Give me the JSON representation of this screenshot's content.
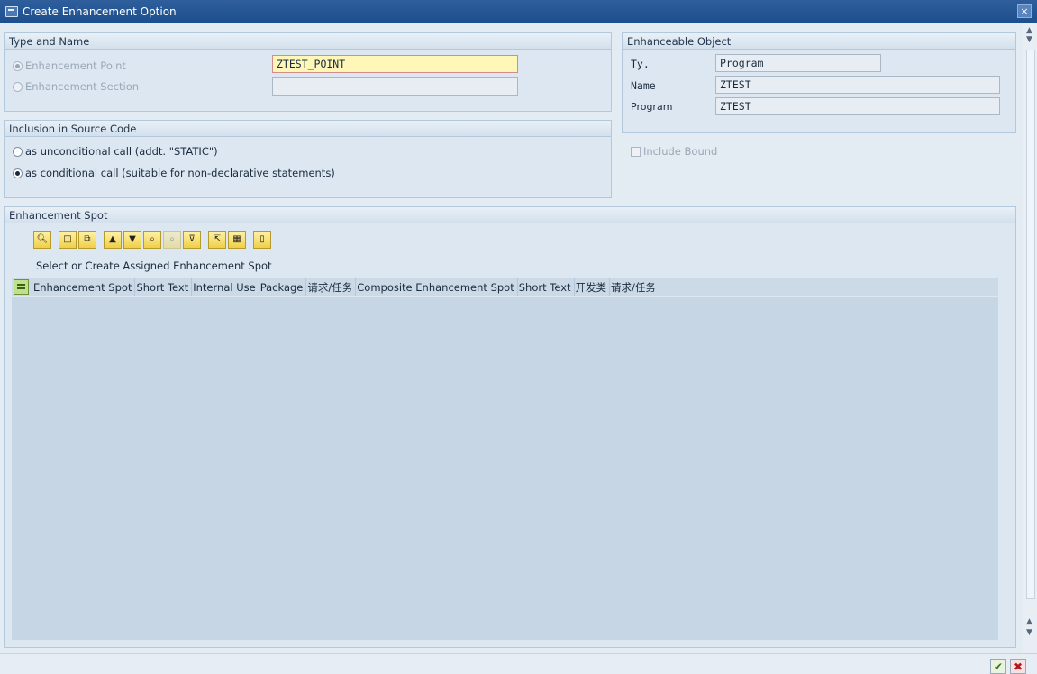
{
  "window": {
    "title": "Create Enhancement Option",
    "close_glyph": "×"
  },
  "type_and_name": {
    "title": "Type and Name",
    "enhancement_point_label": "Enhancement Point",
    "enhancement_section_label": "Enhancement Section",
    "point_value": "ZTEST_POINT",
    "section_value": ""
  },
  "inclusion": {
    "title": "Inclusion in Source Code",
    "unconditional_label": "as unconditional call (addt. \"STATIC\")",
    "conditional_label": "as conditional call (suitable for non-declarative statements)"
  },
  "enhanceable_object": {
    "title": "Enhanceable Object",
    "type_label": "Ty.",
    "type_value": "Program",
    "name_label": "Name",
    "name_value": "ZTEST",
    "program_label": "Program",
    "program_value": "ZTEST",
    "include_bound_label": "Include Bound"
  },
  "enhancement_spot": {
    "title": "Enhancement Spot",
    "table_title": "Select or Create Assigned Enhancement Spot",
    "columns": [
      "Enhancement Spot",
      "Short Text",
      "Internal Use",
      "Package",
      "请求/任务",
      "Composite Enhancement Spot",
      "Short Text",
      "开发类",
      "请求/任务"
    ],
    "toolbar_icons": [
      "details-icon",
      "create-icon",
      "copy-icon",
      "sort-ascending-icon",
      "sort-descending-icon",
      "find-icon",
      "find-next-icon",
      "filter-icon",
      "export-icon",
      "layout-icon",
      "delete-icon"
    ]
  },
  "footer": {
    "ok_glyph": "✔",
    "cancel_glyph": "✖"
  }
}
